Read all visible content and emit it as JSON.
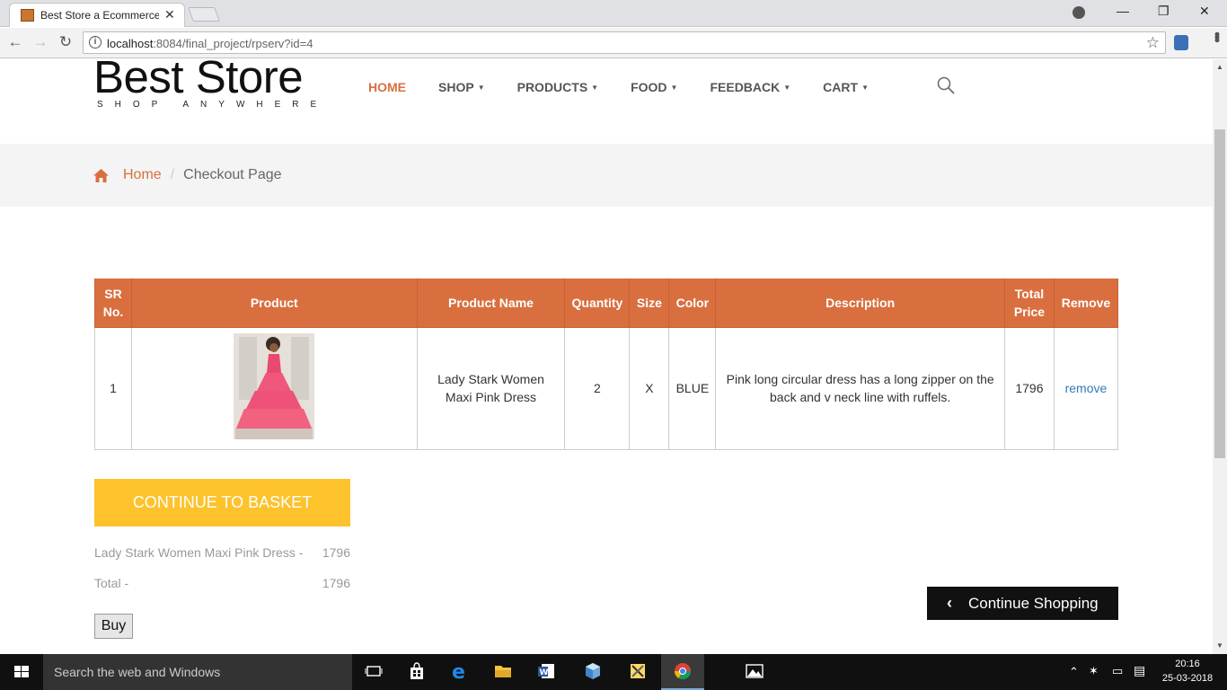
{
  "browser": {
    "tab_title": "Best Store a Ecommerce",
    "url_host": "localhost",
    "url_path": ":8084/final_project/rpserv?id=4"
  },
  "site": {
    "brand_name": "Best Store",
    "brand_tagline": "SHOP ANYWHERE",
    "accent_color": "#d96f3f",
    "nav": {
      "home": "HOME",
      "shop": "SHOP",
      "products": "PRODUCTS",
      "food": "FOOD",
      "feedback": "FEEDBACK",
      "cart": "CART"
    },
    "breadcrumb": {
      "home": "Home",
      "separator": "/",
      "current": "Checkout Page"
    }
  },
  "cart": {
    "headers": {
      "sr": "SR No.",
      "product": "Product",
      "name": "Product Name",
      "quantity": "Quantity",
      "size": "Size",
      "color": "Color",
      "description": "Description",
      "total": "Total Price",
      "remove": "Remove"
    },
    "rows": [
      {
        "sr": "1",
        "image": "pink-dress-image",
        "name": "Lady Stark Women Maxi Pink Dress",
        "quantity": "2",
        "size": "X",
        "color": "BLUE",
        "description": "Pink long circular dress has a long zipper on the back and v neck line with ruffels.",
        "total": "1796",
        "remove": "remove"
      }
    ]
  },
  "summary": {
    "basket_button": "CONTINUE TO BASKET",
    "item_label": "Lady Stark Women Maxi Pink Dress -",
    "item_value": "1796",
    "total_label": "Total -",
    "total_value": "1796",
    "buy_button": "Buy",
    "continue_button": "Continue Shopping"
  },
  "taskbar": {
    "search_placeholder": "Search the web and Windows",
    "time": "20:16",
    "date": "25-03-2018"
  }
}
